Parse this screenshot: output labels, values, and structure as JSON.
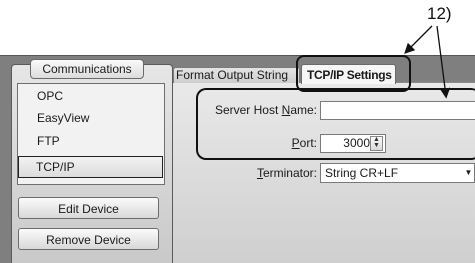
{
  "callout": {
    "label": "12)"
  },
  "sidebar": {
    "title": "Communications",
    "items": [
      {
        "label": "OPC"
      },
      {
        "label": "EasyView"
      },
      {
        "label": "FTP"
      },
      {
        "label": "TCP/IP",
        "selected": true
      }
    ],
    "edit_device_label": "Edit Device",
    "remove_device_label": "Remove Device"
  },
  "tabs": [
    {
      "label": "Format Output String",
      "active": false
    },
    {
      "label": "TCP/IP Settings",
      "active": true
    }
  ],
  "form": {
    "server_host": {
      "label_pre": "Server Host ",
      "label_key": "N",
      "label_post": "ame:",
      "value": ""
    },
    "port": {
      "label_pre": "",
      "label_key": "P",
      "label_post": "ort:",
      "value": "3000"
    },
    "terminator": {
      "label_pre": "",
      "label_key": "T",
      "label_post": "erminator:",
      "value": "String CR+LF"
    }
  }
}
